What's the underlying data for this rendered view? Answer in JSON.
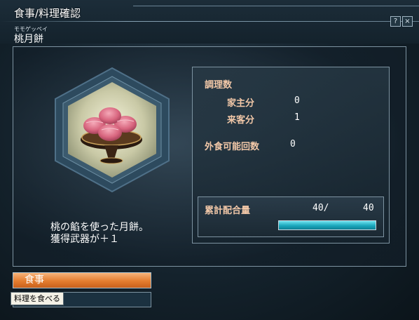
{
  "window": {
    "title": "食事/料理確認",
    "help_label": "?",
    "close_label": "×"
  },
  "item": {
    "furigana": "モモゲッペイ",
    "name": "桃月餅",
    "description": [
      "桃の餡を使った月餅。",
      "獲得武器が＋１"
    ]
  },
  "stats": {
    "cooking_count_label": "調理数",
    "owner_label": "家主分",
    "owner_value": "0",
    "guest_label": "来客分",
    "guest_value": "1",
    "eat_out_label": "外食可能回数",
    "eat_out_value": "0"
  },
  "combination": {
    "label": "累計配合量",
    "current": "40/",
    "max": "40",
    "fraction": 1.0
  },
  "actions": {
    "eat_label": "食事",
    "hint": "料理を食べる"
  },
  "colors": {
    "label_accent": "#f2c8a8",
    "button_orange": "#e47d2f",
    "gauge_cyan": "#1aa7bc",
    "frame_border": "#7d93a1"
  }
}
